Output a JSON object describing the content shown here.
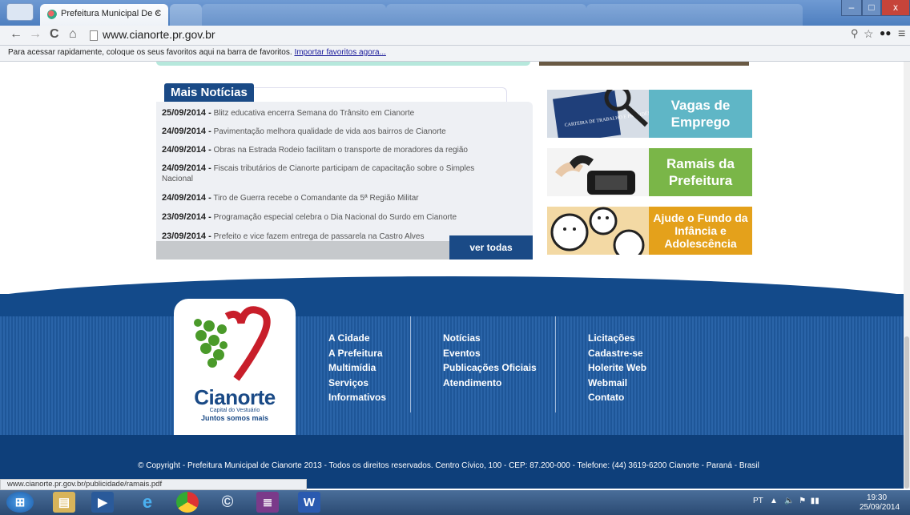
{
  "browser": {
    "tab_title": "Prefeitura Municipal De C",
    "tab_close": "×",
    "address": "www.cianorte.pr.gov.br",
    "bookmarks_text": "Para acessar rapidamente, coloque os seus favoritos aqui na barra de favoritos.",
    "bookmarks_link": "Importar favoritos agora...",
    "win_min": "–",
    "win_max": "□",
    "win_close": "x"
  },
  "news": {
    "title": "Mais Notícias",
    "items": [
      {
        "date": "25/09/2014 -",
        "text": "Blitz educativa encerra Semana do Trânsito em Cianorte"
      },
      {
        "date": "24/09/2014 -",
        "text": "Pavimentação melhora qualidade de vida aos bairros de Cianorte"
      },
      {
        "date": "24/09/2014 -",
        "text": "Obras na Estrada Rodeio facilitam o transporte de moradores da região"
      },
      {
        "date": "24/09/2014 -",
        "text": "Fiscais tributários de Cianorte participam de capacitação sobre o Simples Nacional"
      },
      {
        "date": "24/09/2014 -",
        "text": "Tiro de Guerra recebe o Comandante da 5ª Região Militar"
      },
      {
        "date": "23/09/2014 -",
        "text": "Programação especial celebra o Dia Nacional do Surdo em Cianorte"
      },
      {
        "date": "23/09/2014 -",
        "text": "Prefeito e vice fazem entrega de passarela na Castro Alves"
      }
    ],
    "see_all": "ver todas"
  },
  "side_boxes": {
    "vagas": "Vagas de Emprego",
    "vagas_img_text": "CARTEIRA DE TRABALHO E PREVIDÊNCIA SOCIAL",
    "ramais": "Ramais da Prefeitura",
    "fundo": "Ajude o Fundo da Infância e Adolescência"
  },
  "footer": {
    "logo_name": "Cianorte",
    "logo_sub1": "Capital do Vestuário",
    "logo_sub2": "Juntos somos mais",
    "col1": [
      "A Cidade",
      "A Prefeitura",
      "Multimídia",
      "Serviços",
      "Informativos"
    ],
    "col2": [
      "Notícias",
      "Eventos",
      "Publicações Oficiais",
      "Atendimento"
    ],
    "col3": [
      "Licitações",
      "Cadastre-se",
      "Holerite Web",
      "Webmail",
      "Contato"
    ],
    "copyright": "© Copyright - Prefeitura Municipal de Cianorte 2013 - Todos os direitos reservados. Centro Cívico, 100 - CEP: 87.200-000 - Telefone: (44) 3619-6200 Cianorte - Paraná - Brasil"
  },
  "status_url": "www.cianorte.pr.gov.br/publicidade/ramais.pdf",
  "taskbar": {
    "lang": "PT",
    "time": "19:30",
    "date": "25/09/2014"
  },
  "colors": {
    "brand_blue": "#1a4a86",
    "vagas": "#5fb6c6",
    "ramais": "#7ab648",
    "fundo": "#e4a11b"
  }
}
